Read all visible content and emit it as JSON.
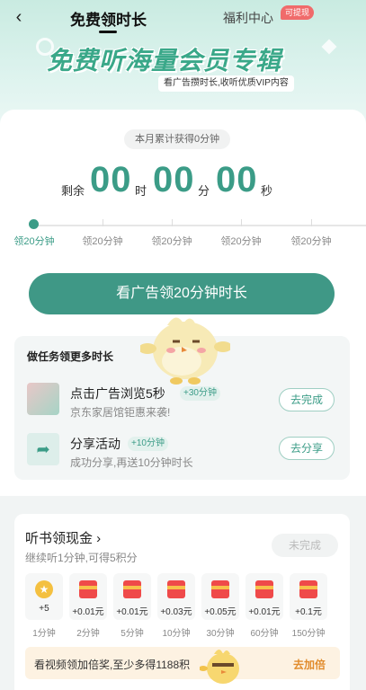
{
  "header": {
    "back_icon": "back-arrow-icon",
    "tab_active": "免费领时长",
    "tab_inactive": "福利中心",
    "badge": "可提现"
  },
  "banner": {
    "title": "免费听海量会员专辑",
    "subtitle": "看广告攒时长,收听优质VIP内容"
  },
  "summary": {
    "month_label": "本月累计获得0分钟"
  },
  "timer": {
    "prefix": "剩余",
    "hours": "00",
    "hours_unit": "时",
    "minutes": "00",
    "minutes_unit": "分",
    "seconds": "00",
    "seconds_unit": "秒"
  },
  "progress": {
    "labels": [
      "领20分钟",
      "领20分钟",
      "领20分钟",
      "领20分钟",
      "领20分钟"
    ]
  },
  "watch_button": "看广告领20分钟时长",
  "tasks": {
    "title": "做任务领更多时长",
    "items": [
      {
        "name": "点击广告浏览5秒",
        "reward": "+30分钟",
        "desc": "京东家居馆钜惠来袭!",
        "button": "去完成"
      },
      {
        "name": "分享活动",
        "reward": "+10分钟",
        "desc": "成功分享,再送10分钟时长",
        "button": "去分享"
      }
    ]
  },
  "cash": {
    "title": "听书领现金 ›",
    "subtitle": "继续听1分钟,可得5积分",
    "button": "未完成",
    "rewards": [
      {
        "amount": "+5",
        "label": "1分钟",
        "type": "coin"
      },
      {
        "amount": "+0.01元",
        "label": "2分钟",
        "type": "redpacket"
      },
      {
        "amount": "+0.01元",
        "label": "5分钟",
        "type": "redpacket"
      },
      {
        "amount": "+0.03元",
        "label": "10分钟",
        "type": "redpacket"
      },
      {
        "amount": "+0.05元",
        "label": "30分钟",
        "type": "redpacket"
      },
      {
        "amount": "+0.01元",
        "label": "60分钟",
        "type": "redpacket"
      },
      {
        "amount": "+0.1元",
        "label": "150分钟",
        "type": "redpacket"
      }
    ],
    "video_text": "看视频领加倍奖,至少多得1188积",
    "video_button": "去加倍"
  },
  "colors": {
    "accent": "#3b9c87",
    "button": "#3f9886",
    "header_bg": "#c9ebe1",
    "badge": "#f06b6b",
    "red_packet": "#ef4a4a"
  }
}
